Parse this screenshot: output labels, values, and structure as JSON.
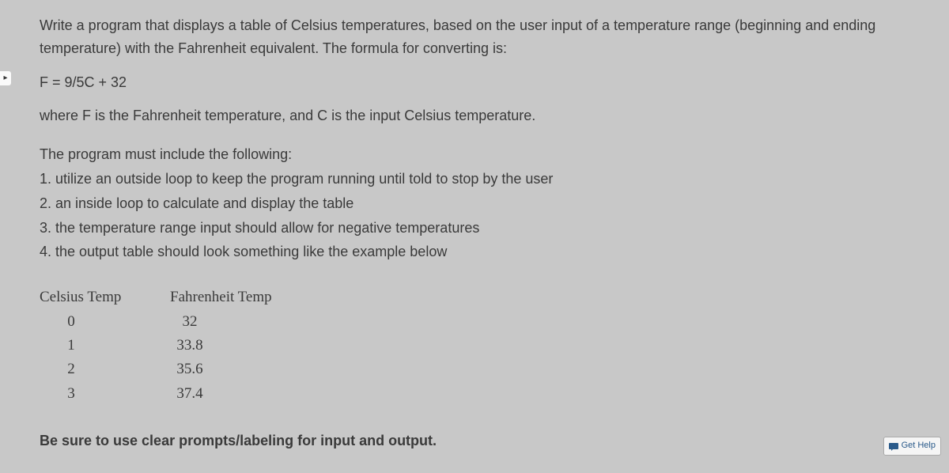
{
  "problem": {
    "intro": "Write a program that displays a table of Celsius temperatures, based on the user input of a temperature range (beginning and ending temperature) with the Fahrenheit equivalent.  The formula for converting is:",
    "formula": "F = 9/5C + 32",
    "where": "where F is the Fahrenheit temperature, and C is the input Celsius temperature.",
    "req_heading": "The program must include the following:",
    "reqs": [
      "1. utilize an outside loop to keep the program running until told to stop by the user",
      "2. an inside loop to calculate and display the table",
      "3. the temperature range input should allow for negative temperatures",
      "4. the output table should look something like the example below"
    ],
    "table": {
      "header_celsius": "Celsius Temp",
      "header_fahrenheit": "Fahrenheit Temp",
      "rows": [
        {
          "c": "0",
          "f": "32"
        },
        {
          "c": "1",
          "f": "33.8"
        },
        {
          "c": "2",
          "f": "35.6"
        },
        {
          "c": "3",
          "f": "37.4"
        }
      ]
    },
    "footer_note": "Be sure to use clear prompts/labeling for input and output."
  },
  "ui": {
    "get_help_label": "Get Help",
    "expand_handle": "▸"
  }
}
